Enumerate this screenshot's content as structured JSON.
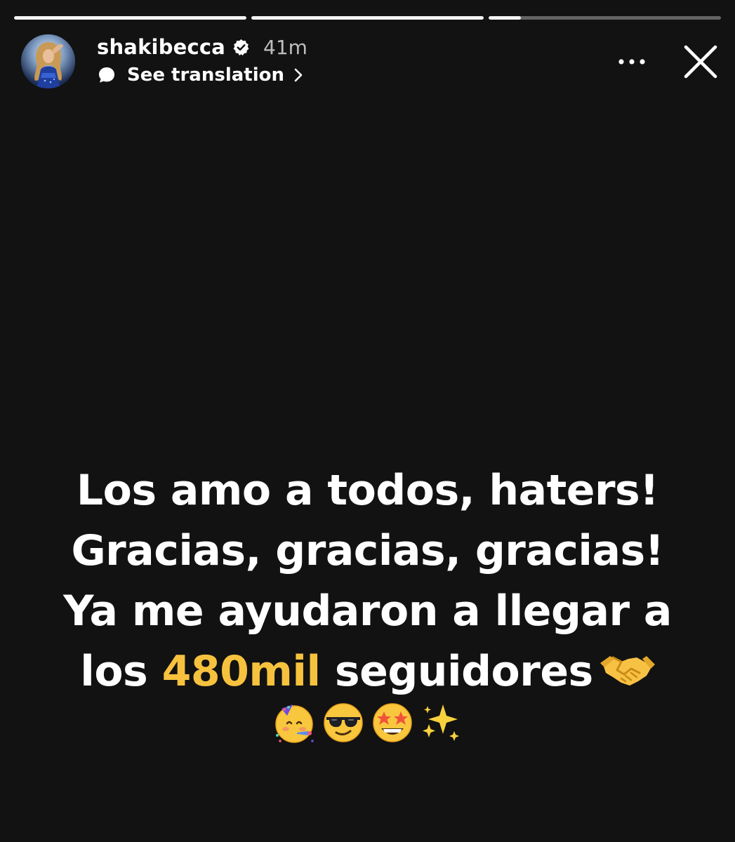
{
  "story": {
    "progress": [
      1.0,
      1.0,
      0.14
    ]
  },
  "header": {
    "username": "shakibecca",
    "timestamp": "41m",
    "translate_label": "See translation",
    "avatar_icon": "profile-avatar",
    "verified_icon": "verified-badge-icon",
    "more_icon": "more-options-icon",
    "close_icon": "close-icon"
  },
  "caption": {
    "line1": "Los amo a todos, haters!",
    "line2": "Gracias, gracias, gracias!",
    "line3": "Ya me ayudaron a llegar a",
    "line4_prefix": "los ",
    "line4_highlight": "480mil",
    "line4_suffix": " seguidores",
    "emojis": [
      "partying-face-emoji",
      "sunglasses-face-emoji",
      "star-struck-emoji",
      "sparkles-emoji"
    ],
    "handshake_icon": "handshake-emoji"
  },
  "colors": {
    "background": "#121212",
    "highlight": "#f6c23e",
    "text": "#ffffff"
  }
}
